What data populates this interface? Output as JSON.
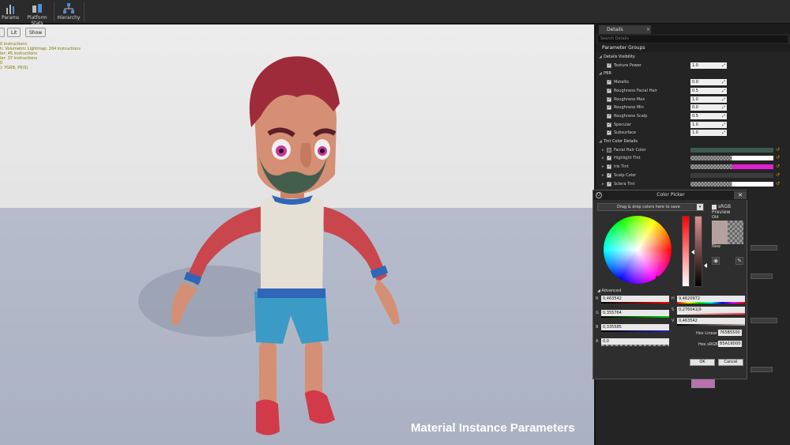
{
  "toolbar": {
    "params_label": "Params",
    "platform_stats_label": "Platform Stats",
    "hierarchy_label": "Hierarchy"
  },
  "viewport": {
    "lit_label": "Lit",
    "show_label": "Show",
    "stats_lines": [
      "0 instructions",
      "h: Volumetric Lightmap: 264 instructions",
      "ler: 45 instructions",
      "ler: 37 instructions",
      "0",
      "): YGRB, P6(S)"
    ],
    "caption": "Material Instance Parameters"
  },
  "details": {
    "tab_label": "Details",
    "search_placeholder": "Search Details",
    "group_title": "Parameter Groups",
    "rows": [
      {
        "kind": "category",
        "label": "Details Visibility"
      },
      {
        "kind": "scalar",
        "label": "Texture Power",
        "value": "1.0"
      },
      {
        "kind": "category",
        "label": "PBR"
      },
      {
        "kind": "scalar",
        "label": "Metallic",
        "value": "0.0"
      },
      {
        "kind": "scalar",
        "label": "Roughness Facial Hair",
        "value": "0.5"
      },
      {
        "kind": "scalar",
        "label": "Roughness Max",
        "value": "1.0"
      },
      {
        "kind": "scalar",
        "label": "Roughness Min",
        "value": "0.0"
      },
      {
        "kind": "scalar",
        "label": "Roughness Scalp",
        "value": "0.5"
      },
      {
        "kind": "scalar",
        "label": "Specular",
        "value": "1.0"
      },
      {
        "kind": "scalar",
        "label": "Subsurface",
        "value": "1.0"
      },
      {
        "kind": "category",
        "label": "Tint Color Details"
      },
      {
        "kind": "color",
        "label": "Facial Hair Color",
        "checked": false,
        "color": "#3c5a52",
        "checker": false
      },
      {
        "kind": "color",
        "label": "Highlight Tint",
        "checked": true,
        "color": "#ffffff",
        "checker": true
      },
      {
        "kind": "color",
        "label": "Iris Tint",
        "checked": true,
        "color": "#e020d0",
        "checker": true
      },
      {
        "kind": "color",
        "label": "Scalp Color",
        "checked": true,
        "color": "#3c3c3c",
        "checker": false
      },
      {
        "kind": "color",
        "label": "Sclera Tint",
        "checked": true,
        "color": "#ffffff",
        "checker": true
      }
    ]
  },
  "color_picker": {
    "title": "Color Picker",
    "close_label": "✕",
    "drag_label": "Drag & drop colors here to save",
    "srgb_preview_label": "sRGB Preview",
    "old_label": "Old",
    "new_label": "New",
    "old_color": "#b5a19d",
    "advanced_label": "Advanced",
    "rgba": {
      "r": {
        "letter": "R",
        "value": "0,463542"
      },
      "g": {
        "letter": "G",
        "value": "0,355764"
      },
      "b": {
        "letter": "B",
        "value": "0,335585"
      },
      "a": {
        "letter": "A",
        "value": "0,0"
      }
    },
    "hsv": {
      "h": {
        "letter": "H",
        "value": "9,4620972"
      },
      "s": {
        "letter": "S",
        "value": "0,276041|9"
      },
      "v": {
        "letter": "V",
        "value": "0,463542"
      }
    },
    "hex_linear_label": "Hex Linear",
    "hex_linear_value": "765B5500",
    "hex_srgb_label": "Hex sRGB",
    "hex_srgb_value": "B5A19D00",
    "ok_label": "OK",
    "cancel_label": "Cancel"
  }
}
